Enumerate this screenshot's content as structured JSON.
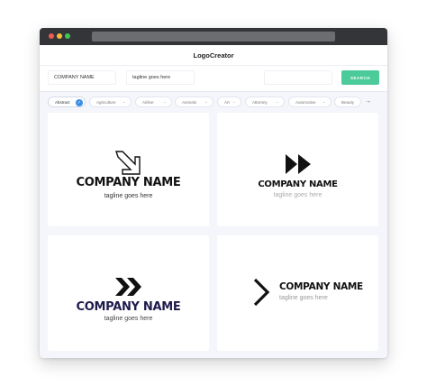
{
  "app": {
    "title": "LogoCreator"
  },
  "search": {
    "company_value": "COMPANY NAME",
    "tagline_value": "tagline goes here",
    "keyword_placeholder": "",
    "button_label": "SEARCH"
  },
  "filters": [
    {
      "label": "Abstract",
      "active": true
    },
    {
      "label": "Agriculture"
    },
    {
      "label": "Airline"
    },
    {
      "label": "Animals"
    },
    {
      "label": "Art"
    },
    {
      "label": "Attorney"
    },
    {
      "label": "Automotive"
    },
    {
      "label": "Beauty"
    }
  ],
  "filters_more_icon": "arrow-right-icon",
  "logos": [
    {
      "icon": "diagonal-arrow-icon",
      "company": "COMPANY NAME",
      "tagline": "tagline goes here"
    },
    {
      "icon": "fast-forward-icon",
      "company": "COMPANY NAME",
      "tagline": "tagline goes here"
    },
    {
      "icon": "double-chevron-icon",
      "company": "COMPANY NAME",
      "tagline": "tagline goes here",
      "color": "#1e1b4b"
    },
    {
      "icon": "chevron-right-icon",
      "company": "COMPANY NAME",
      "tagline": "tagline goes here"
    }
  ],
  "colors": {
    "accent": "#4ccb9a",
    "chip_check": "#3a8ee6",
    "chrome": "#333538"
  }
}
